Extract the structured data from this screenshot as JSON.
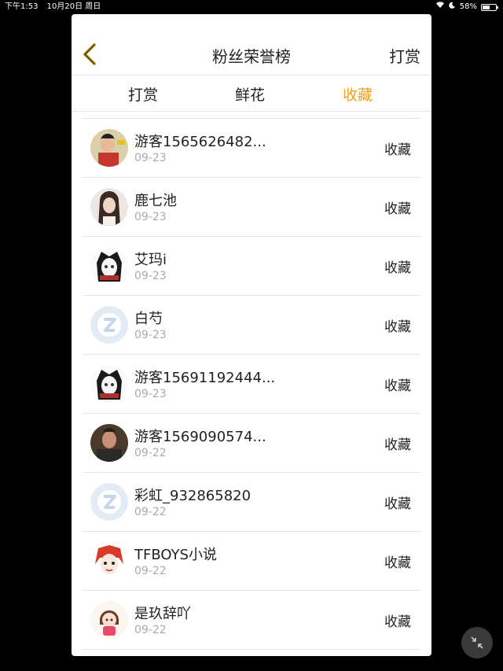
{
  "status_bar": {
    "time": "下午1:53",
    "date": "10月20日 周日",
    "battery": "58%",
    "battery_level": 0.58
  },
  "header": {
    "title": "粉丝荣誉榜",
    "right_action": "打赏"
  },
  "tabs": [
    {
      "label": "打赏",
      "active": false
    },
    {
      "label": "鲜花",
      "active": false
    },
    {
      "label": "收藏",
      "active": true
    }
  ],
  "accent_color": "#f0a020",
  "list": [
    {
      "name": "游客1565626482...",
      "date": "09-23",
      "action": "收藏",
      "avatar": "photo-avatar-child"
    },
    {
      "name": "鹿七池",
      "date": "09-23",
      "action": "收藏",
      "avatar": "photo-avatar-girl"
    },
    {
      "name": "艾玛i",
      "date": "09-23",
      "action": "收藏",
      "avatar": "anime-avatar"
    },
    {
      "name": "白芍",
      "date": "09-23",
      "action": "收藏",
      "avatar": "default-avatar-icon"
    },
    {
      "name": "游客15691192444...",
      "date": "09-23",
      "action": "收藏",
      "avatar": "anime-avatar"
    },
    {
      "name": "游客1569090574...",
      "date": "09-22",
      "action": "收藏",
      "avatar": "photo-avatar-man"
    },
    {
      "name": "彩虹_932865820",
      "date": "09-22",
      "action": "收藏",
      "avatar": "default-avatar-icon"
    },
    {
      "name": "TFBOYS小说",
      "date": "09-22",
      "action": "收藏",
      "avatar": "anime-avatar-redhair"
    },
    {
      "name": "是玖辞吖",
      "date": "09-22",
      "action": "收藏",
      "avatar": "cartoon-avatar-girl"
    }
  ]
}
